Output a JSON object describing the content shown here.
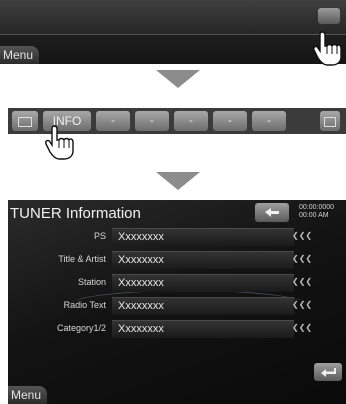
{
  "panel1": {
    "menu_label": "Menu"
  },
  "panel2": {
    "info_label": "INFO",
    "dash_labels": [
      "-",
      "-",
      "-",
      "-",
      "-"
    ]
  },
  "panel3": {
    "title": "TUNER Information",
    "time_line1": "00:00:0000",
    "time_line2": "00:00 AM",
    "rows": [
      {
        "label": "PS",
        "value": "Xxxxxxxx"
      },
      {
        "label": "Title & Artist",
        "value": "Xxxxxxxx"
      },
      {
        "label": "Station",
        "value": "Xxxxxxxx"
      },
      {
        "label": "Radio Text",
        "value": "Xxxxxxxx"
      },
      {
        "label": "Category1/2",
        "value": "Xxxxxxxx"
      }
    ],
    "menu_label": "Menu"
  },
  "icons": {
    "hand": "pointing-hand-icon",
    "arrow": "down-arrow-icon",
    "back": "return-icon",
    "scroll": "scroll-icon"
  }
}
